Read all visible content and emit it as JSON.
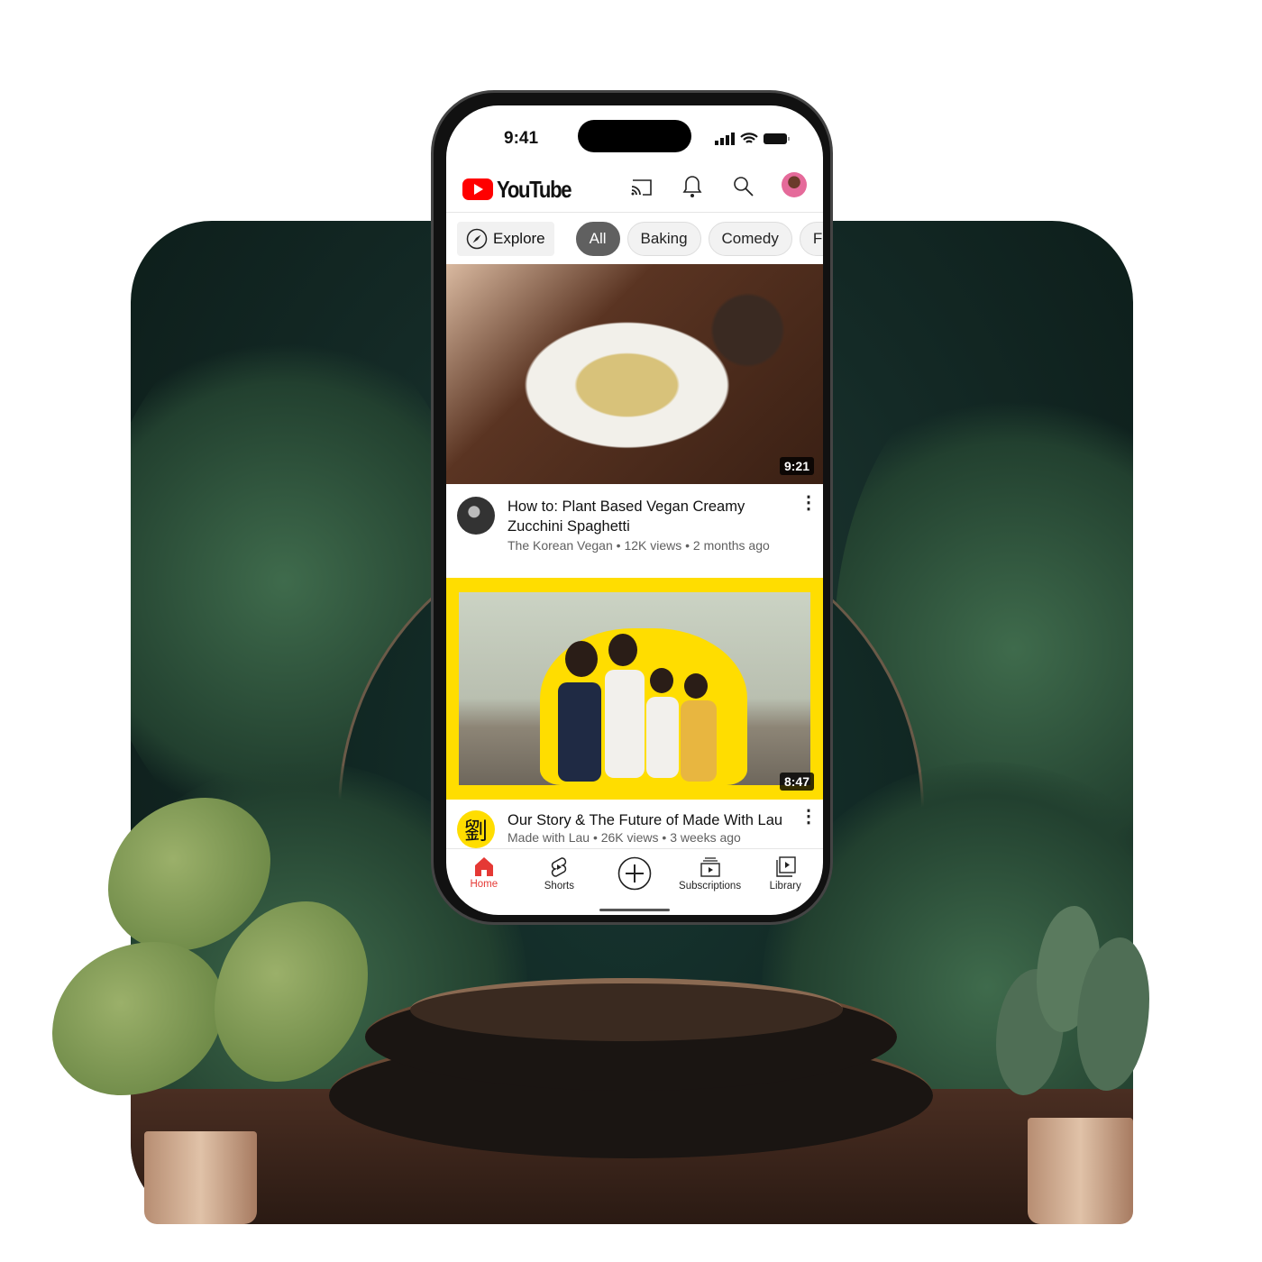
{
  "status_bar": {
    "time": "9:41"
  },
  "header": {
    "logo_text": "YouTube",
    "icons": [
      "cast-icon",
      "bell-icon",
      "search-icon",
      "avatar"
    ]
  },
  "chips": {
    "explore_label": "Explore",
    "items": [
      {
        "label": "All",
        "active": true
      },
      {
        "label": "Baking"
      },
      {
        "label": "Comedy"
      },
      {
        "label": "Fa"
      }
    ]
  },
  "videos": [
    {
      "title": "How to: Plant Based Vegan Creamy Zucchini Spaghetti",
      "channel": "The Korean Vegan",
      "views": "12K views",
      "age": "2 months ago",
      "meta": "The Korean Vegan • 12K views • 2 months ago",
      "duration": "9:21"
    },
    {
      "title": "Our Story & The Future of Made With Lau",
      "channel": "Made with Lau",
      "views": "26K views",
      "age": "3 weeks ago",
      "meta": "Made with Lau • 26K views • 3 weeks ago",
      "duration": "8:47",
      "avatar_glyph": "劉"
    }
  ],
  "nav": {
    "items": [
      {
        "label": "Home",
        "icon": "home-icon",
        "active": true
      },
      {
        "label": "Shorts",
        "icon": "shorts-icon"
      },
      {
        "label": "",
        "icon": "create-plus-icon"
      },
      {
        "label": "Subscriptions",
        "icon": "subscriptions-icon"
      },
      {
        "label": "Library",
        "icon": "library-icon"
      }
    ]
  },
  "colors": {
    "brand_red": "#ff0000",
    "active_chip": "#606060",
    "highlight_yellow": "#ffdd00",
    "scene_green": "#142a26"
  }
}
